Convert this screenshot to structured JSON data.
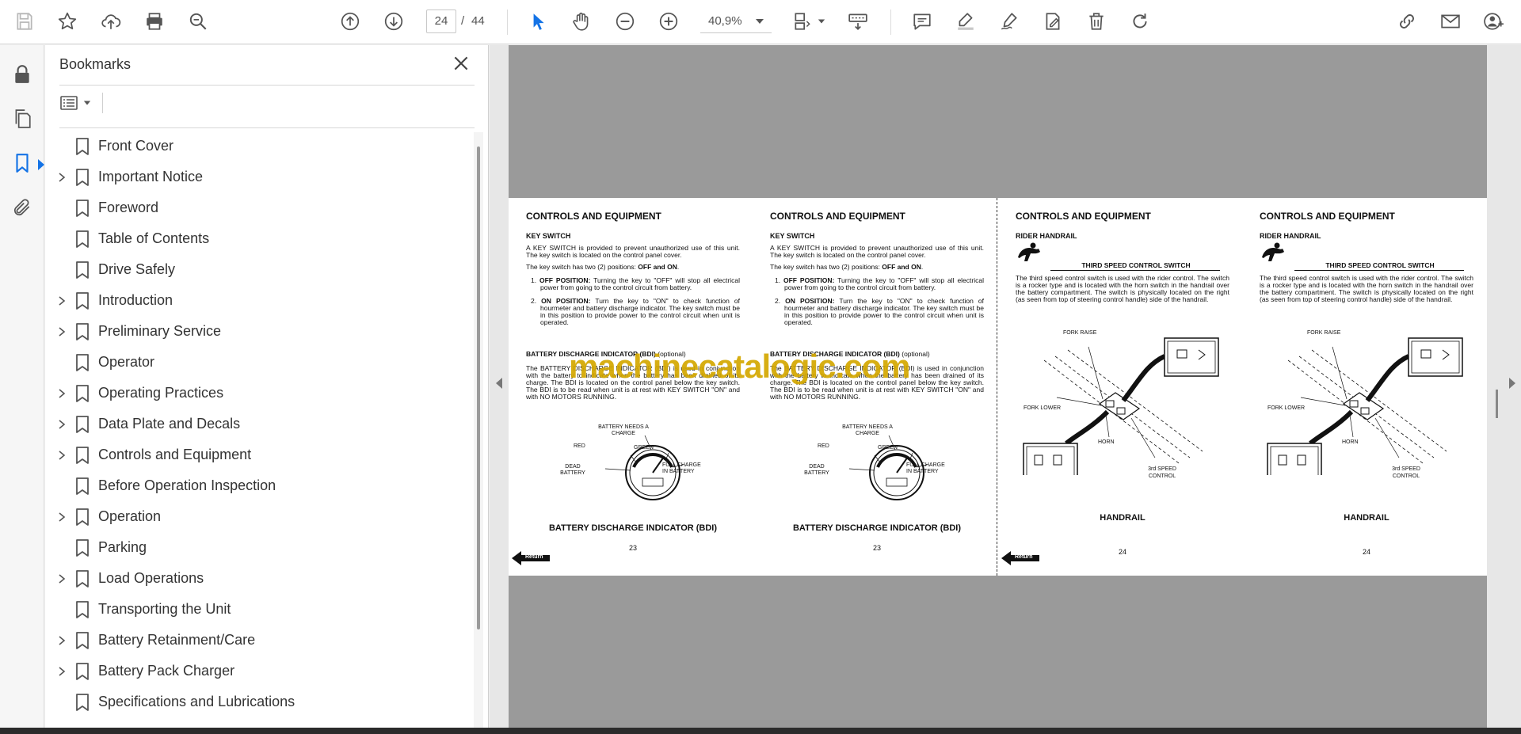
{
  "toolbar": {
    "current_page": "24",
    "page_separator": "/",
    "total_pages": "44",
    "zoom": "40,9%",
    "icons": [
      "save-icon",
      "star-icon",
      "upload-icon",
      "print-icon",
      "zoom-search-icon",
      "page-up-icon",
      "page-down-icon",
      "select-cursor-icon",
      "hand-icon",
      "zoom-out-icon",
      "zoom-in-icon",
      "page-fit-icon",
      "scroll-mode-icon",
      "comment-icon",
      "highlight-icon",
      "sign-icon",
      "edit-page-icon",
      "trash-icon",
      "rotate-icon",
      "share-link-icon",
      "email-icon",
      "user-icon"
    ]
  },
  "leftrail": {
    "icons": [
      "lock-icon",
      "pages-icon",
      "bookmark-icon",
      "attachment-icon"
    ],
    "active": "bookmark-icon"
  },
  "bookmarks": {
    "title": "Bookmarks",
    "items": [
      {
        "label": "Front Cover",
        "expandable": false
      },
      {
        "label": "Important Notice",
        "expandable": true
      },
      {
        "label": "Foreword",
        "expandable": false
      },
      {
        "label": "Table of Contents",
        "expandable": false
      },
      {
        "label": "Drive Safely",
        "expandable": false
      },
      {
        "label": "Introduction",
        "expandable": true
      },
      {
        "label": "Preliminary Service",
        "expandable": true
      },
      {
        "label": "Operator",
        "expandable": false
      },
      {
        "label": "Operating Practices",
        "expandable": true
      },
      {
        "label": "Data Plate and Decals",
        "expandable": true
      },
      {
        "label": "Controls and Equipment",
        "expandable": true
      },
      {
        "label": "Before Operation Inspection",
        "expandable": false
      },
      {
        "label": "Operation",
        "expandable": true
      },
      {
        "label": "Parking",
        "expandable": false
      },
      {
        "label": "Load Operations",
        "expandable": true
      },
      {
        "label": "Transporting the Unit",
        "expandable": false
      },
      {
        "label": "Battery Retainment/Care",
        "expandable": true
      },
      {
        "label": "Battery Pack Charger",
        "expandable": true
      },
      {
        "label": "Specifications and Lubrications",
        "expandable": false
      }
    ]
  },
  "document": {
    "watermark": "machinecatalogic.com",
    "left_spread": {
      "heading": "CONTROLS AND EQUIPMENT",
      "key_switch_title": "KEY SWITCH",
      "key_switch_p1": "A KEY SWITCH is provided to prevent unauthorized use of this unit.  The key switch is located on the control panel cover.",
      "key_switch_p2a": "The key switch has two (2) positions: ",
      "key_switch_p2b": "OFF and ON",
      "key_switch_p2c": ".",
      "off_label": "OFF POSITION:",
      "off_text": "Turning the key to \"OFF\" will stop all electrical power from going to the control circuit from battery.",
      "on_label": "ON POSITION:",
      "on_text": "Turn the key to \"ON\" to check function of hourmeter and battery discharge indicator.  The key switch must be in this position to provide power to the control circuit when unit is operated.",
      "bdi_title": "BATTERY DISCHARGE INDICATOR (BDI)",
      "bdi_optional": " (optional)",
      "bdi_text": "The BATTERY DISCHARGE INDICATOR (BDI) is used in conjunction with the battery to indicate when the battery has been drained of its charge.  The BDI is located on the control panel below the key switch.  The BDI is to be read when unit is at rest with KEY SWITCH \"ON\" and with NO MOTORS RUNNING.",
      "gauge_labels": {
        "needs_charge": "BATTERY NEEDS A CHARGE",
        "red": "RED",
        "green": "GREEN",
        "dead": "DEAD BATTERY",
        "full": "FULL CHARGE IN BATTERY"
      },
      "caption": "BATTERY DISCHARGE INDICATOR (BDI)",
      "page_number": "23",
      "return_label": "Return"
    },
    "right_spread": {
      "heading": "CONTROLS AND EQUIPMENT",
      "rider_handrail": "RIDER HANDRAIL",
      "third_speed_title": "THIRD SPEED CONTROL SWITCH",
      "third_speed_text": "The third speed control switch is used with the rider control.  The switch is a rocker type and is located with the horn switch in the handrail over the battery compartment.  The switch is physically located on the right (as seen from top of steering control handle) side of the handrail.",
      "diagram_labels": {
        "fork_raise": "FORK RAISE",
        "fork_lower": "FORK LOWER",
        "horn": "HORN",
        "speed": "3rd SPEED CONTROL"
      },
      "caption": "HANDRAIL",
      "page_number": "24",
      "return_label": "Return"
    }
  }
}
